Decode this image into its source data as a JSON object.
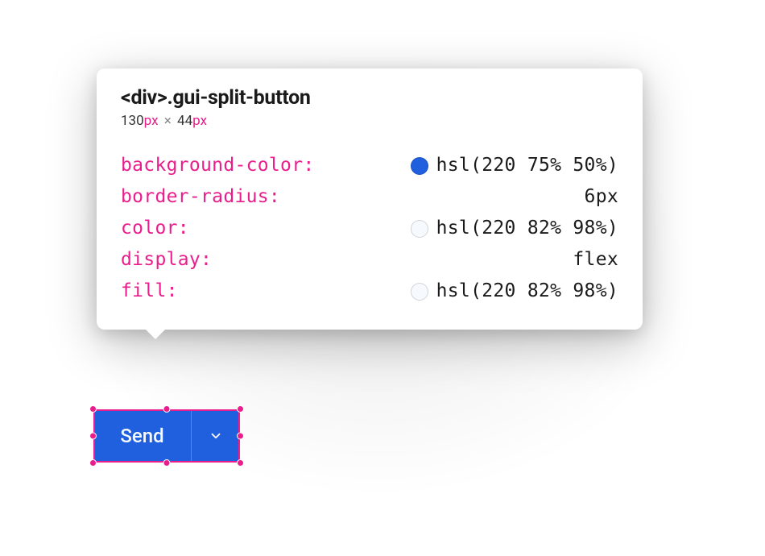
{
  "tooltip": {
    "selector_tag": "<div>",
    "selector_class": ".gui-split-button",
    "width_num": "130",
    "width_unit": "px",
    "height_num": "44",
    "height_unit": "px",
    "sep": "×",
    "props": [
      {
        "name": "background-color",
        "value": "hsl(220 75% 50%)",
        "swatch": "blue"
      },
      {
        "name": "border-radius",
        "value": "6px",
        "swatch": null
      },
      {
        "name": "color",
        "value": "hsl(220 82% 98%)",
        "swatch": "light"
      },
      {
        "name": "display",
        "value": "flex",
        "swatch": null
      },
      {
        "name": "fill",
        "value": "hsl(220 82% 98%)",
        "swatch": "light"
      }
    ]
  },
  "button": {
    "label": "Send"
  }
}
